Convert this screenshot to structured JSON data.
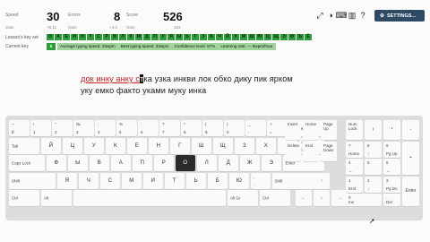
{
  "stats": [
    {
      "value": "30",
      "label": "Speed",
      "delta": "+8.11"
    },
    {
      "value": "8",
      "label": "Errors",
      "delta": "+4.3"
    },
    {
      "value": "526",
      "label": "Score",
      "delta": "363"
    }
  ],
  "stat_sublabels": {
    "speed": "Gain",
    "errors": "Gain",
    "score": "Gain"
  },
  "rows": {
    "lessons_label": "Lesson's key set",
    "current_label": "Current key"
  },
  "letters": [
    "О",
    "А",
    "Е",
    "И",
    "Н",
    "Т",
    "С",
    "Р",
    "В",
    "Л",
    "К",
    "М",
    "Д",
    "П",
    "У",
    "Я",
    "Ы",
    "Ь",
    "Г",
    "З",
    "Б",
    "Ч",
    "Й",
    "Х",
    "Ж",
    "Ш",
    "Ю",
    "Ц",
    "Щ",
    "Э",
    "Ф",
    "Ъ",
    "Ё"
  ],
  "current_key": {
    "letter": "К",
    "segments": [
      "Average typing speed: 33wpm",
      "Best typing speed: 33wpm",
      "Confidence level: 87%",
      "Learning rate: — 5wpm/hour"
    ]
  },
  "toolbar": {
    "settings_label": "SETTINGS..."
  },
  "icons": [
    "expand-icon",
    "contrast-icon",
    "keyboard-icon",
    "book-icon",
    "help-icon",
    "gear-icon"
  ],
  "text": {
    "line1_typed": "док инку анку с",
    "line1_cursor": "т",
    "line1_rest": "ка узка инкви лок обко дику пик ярком",
    "line2": "уку емко факто уками муку инка"
  },
  "keyboard": {
    "row1": [
      [
        "~",
        "Ё"
      ],
      [
        "!",
        "1"
      ],
      [
        "\"",
        "2"
      ],
      [
        "№",
        "3"
      ],
      [
        ";",
        "4"
      ],
      [
        "%",
        "5"
      ],
      [
        ":",
        "6"
      ],
      [
        "?",
        "7"
      ],
      [
        "*",
        "8"
      ],
      [
        "(",
        "9"
      ],
      [
        ")",
        "0"
      ],
      [
        "_",
        "-"
      ],
      [
        "+",
        "="
      ]
    ],
    "backspace": "Backspace",
    "tab": "Tab",
    "row2": [
      "Й",
      "Ц",
      "У",
      "К",
      "Е",
      "Н",
      "Г",
      "Ш",
      "Щ",
      "З",
      "Х",
      "Ъ"
    ],
    "slash": [
      "/",
      "\\"
    ],
    "caps": "Caps Lock",
    "row3": [
      "Ф",
      "Ы",
      "В",
      "А",
      "П",
      "Р",
      "О",
      "Л",
      "Д",
      "Ж",
      "Э"
    ],
    "enter": "Enter",
    "shift": "Shift",
    "row4": [
      "Я",
      "Ч",
      "С",
      "М",
      "И",
      "Т",
      "Ь",
      "Б",
      "Ю"
    ],
    "row4_last": [
      ",",
      "."
    ],
    "shift_r": "Shift",
    "ctrl": "Ctrl",
    "alt": "Alt",
    "altgr": "Alt Gr",
    "ctrl_r": "Ctrl",
    "nav": [
      "Insert",
      "Home",
      "Page Up",
      "Delete",
      "End",
      "Page Down"
    ],
    "arrows": [
      "↑",
      "←",
      "↓",
      "→"
    ],
    "numlock": "Num Lock",
    "np": [
      [
        "/",
        "*",
        "-"
      ],
      [
        "7",
        "Home",
        "8",
        "↑",
        "9",
        "Pg Up"
      ],
      [
        "4",
        "←",
        "5",
        "",
        "6",
        "→"
      ],
      [
        "1",
        "End",
        "2",
        "↓",
        "3",
        "Pg Dn"
      ],
      [
        "0",
        "Ins",
        ".",
        "Del"
      ]
    ],
    "np_plus": "+",
    "np_enter": "Enter"
  },
  "highlight_key": "О"
}
